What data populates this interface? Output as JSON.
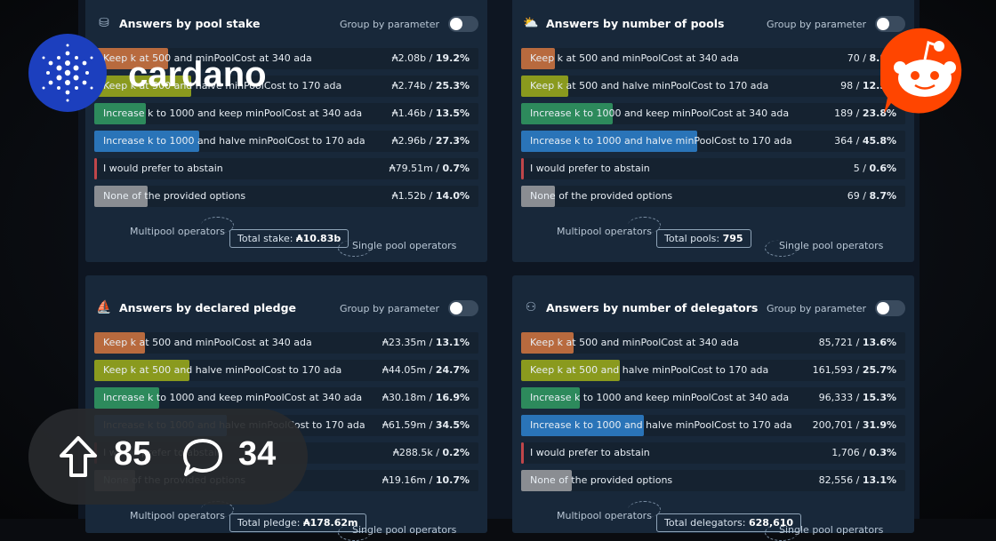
{
  "brand": {
    "name": "cardano"
  },
  "stats": {
    "upvotes": "85",
    "comments": "34"
  },
  "panels": [
    {
      "title": "Answers by pool stake",
      "icon": "stake-icon",
      "group_label": "Group by parameter",
      "rows": [
        {
          "label": "Keep k at 500 and minPoolCost at 340 ada",
          "value": "₳2.08b / ",
          "pct": "19.2%",
          "color": "#b86a3e",
          "fill": 0.192
        },
        {
          "label": "Keep k at 500 and halve minPoolCost to 170 ada",
          "value": "₳2.74b / ",
          "pct": "25.3%",
          "color": "#8a9a1e",
          "fill": 0.253
        },
        {
          "label": "Increase k to 1000 and keep minPoolCost at 340 ada",
          "value": "₳1.46b / ",
          "pct": "13.5%",
          "color": "#2d8a5c",
          "fill": 0.135
        },
        {
          "label": "Increase k to 1000 and halve minPoolCost to 170 ada",
          "value": "₳2.96b / ",
          "pct": "27.3%",
          "color": "#2a74b8",
          "fill": 0.273
        },
        {
          "label": "I would prefer to abstain",
          "value": "₳79.51m / ",
          "pct": "0.7%",
          "color": "#c0464a",
          "fill": 0.007
        },
        {
          "label": "None of the provided options",
          "value": "₳1.52b / ",
          "pct": "14.0%",
          "color": "#8a8d92",
          "fill": 0.14
        }
      ],
      "foot_left": "Multipool operators",
      "total_label": "Total stake: ",
      "total_value": "₳10.83b",
      "foot_right": "Single pool operators"
    },
    {
      "title": "Answers by number of pools",
      "icon": "pools-icon",
      "group_label": "Group by parameter",
      "rows": [
        {
          "label": "Keep k at 500 and minPoolCost at 340 ada",
          "value": "70 / ",
          "pct": "8.8%",
          "color": "#b86a3e",
          "fill": 0.088
        },
        {
          "label": "Keep k at 500 and halve minPoolCost to 170 ada",
          "value": "98 / ",
          "pct": "12.3%",
          "color": "#8a9a1e",
          "fill": 0.123
        },
        {
          "label": "Increase k to 1000 and keep minPoolCost at 340 ada",
          "value": "189 / ",
          "pct": "23.8%",
          "color": "#2d8a5c",
          "fill": 0.238
        },
        {
          "label": "Increase k to 1000 and halve minPoolCost to 170 ada",
          "value": "364 / ",
          "pct": "45.8%",
          "color": "#2a74b8",
          "fill": 0.458
        },
        {
          "label": "I would prefer to abstain",
          "value": "5 / ",
          "pct": "0.6%",
          "color": "#c0464a",
          "fill": 0.006
        },
        {
          "label": "None of the provided options",
          "value": "69 / ",
          "pct": "8.7%",
          "color": "#8a8d92",
          "fill": 0.087
        }
      ],
      "foot_left": "Multipool operators",
      "total_label": "Total pools: ",
      "total_value": "795",
      "foot_right": "Single pool operators"
    },
    {
      "title": "Answers by declared pledge",
      "icon": "pledge-icon",
      "group_label": "Group by parameter",
      "rows": [
        {
          "label": "Keep k at 500 and minPoolCost at 340 ada",
          "value": "₳23.35m / ",
          "pct": "13.1%",
          "color": "#b86a3e",
          "fill": 0.131
        },
        {
          "label": "Keep k at 500 and halve minPoolCost to 170 ada",
          "value": "₳44.05m / ",
          "pct": "24.7%",
          "color": "#8a9a1e",
          "fill": 0.247
        },
        {
          "label": "Increase k to 1000 and keep minPoolCost at 340 ada",
          "value": "₳30.18m / ",
          "pct": "16.9%",
          "color": "#2d8a5c",
          "fill": 0.169
        },
        {
          "label": "Increase k to 1000 and halve minPoolCost to 170 ada",
          "value": "₳61.59m / ",
          "pct": "34.5%",
          "color": "#2a74b8",
          "fill": 0.345
        },
        {
          "label": "I would prefer to abstain",
          "value": "₳288.5k / ",
          "pct": "0.2%",
          "color": "#c0464a",
          "fill": 0.002
        },
        {
          "label": "None of the provided options",
          "value": "₳19.16m / ",
          "pct": "10.7%",
          "color": "#8a8d92",
          "fill": 0.107
        }
      ],
      "foot_left": "Multipool operators",
      "total_label": "Total pledge: ",
      "total_value": "₳178.62m",
      "foot_right": "Single pool operators"
    },
    {
      "title": "Answers by number of delegators",
      "icon": "delegators-icon",
      "group_label": "Group by parameter",
      "rows": [
        {
          "label": "Keep k at 500 and minPoolCost at 340 ada",
          "value": "85,721 / ",
          "pct": "13.6%",
          "color": "#b86a3e",
          "fill": 0.136
        },
        {
          "label": "Keep k at 500 and halve minPoolCost to 170 ada",
          "value": "161,593 / ",
          "pct": "25.7%",
          "color": "#8a9a1e",
          "fill": 0.257
        },
        {
          "label": "Increase k to 1000 and keep minPoolCost at 340 ada",
          "value": "96,333 / ",
          "pct": "15.3%",
          "color": "#2d8a5c",
          "fill": 0.153
        },
        {
          "label": "Increase k to 1000 and halve minPoolCost to 170 ada",
          "value": "200,701 / ",
          "pct": "31.9%",
          "color": "#2a74b8",
          "fill": 0.319
        },
        {
          "label": "I would prefer to abstain",
          "value": "1,706 / ",
          "pct": "0.3%",
          "color": "#c0464a",
          "fill": 0.003
        },
        {
          "label": "None of the provided options",
          "value": "82,556 / ",
          "pct": "13.1%",
          "color": "#8a8d92",
          "fill": 0.131
        }
      ],
      "foot_left": "Multipool operators",
      "total_label": "Total delegators: ",
      "total_value": "628,610",
      "foot_right": "Single pool operators"
    }
  ]
}
